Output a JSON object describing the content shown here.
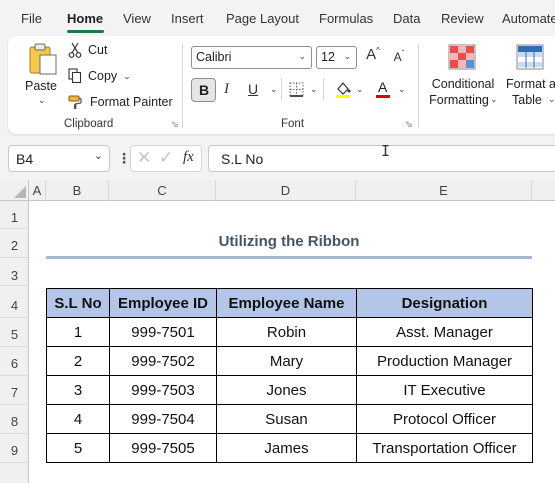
{
  "menu": {
    "tabs": [
      "File",
      "Home",
      "View",
      "Insert",
      "Page Layout",
      "Formulas",
      "Data",
      "Review",
      "Automate"
    ],
    "active": "Home"
  },
  "ribbon": {
    "clipboard": {
      "paste_label": "Paste",
      "cut_label": "Cut",
      "copy_label": "Copy",
      "format_painter_label": "Format Painter",
      "group_label": "Clipboard"
    },
    "font": {
      "font_name": "Calibri",
      "font_size": "12",
      "bold": "B",
      "italic": "I",
      "underline": "U",
      "grow": "A",
      "shrink": "A",
      "font_color_letter": "A",
      "group_label": "Font"
    },
    "styles": {
      "conditional_line1": "Conditional",
      "conditional_line2": "Formatting",
      "format_as_line1": "Format as",
      "format_as_line2": "Table"
    }
  },
  "formula_bar": {
    "name_box": "B4",
    "fx": "fx",
    "value": "S.L No"
  },
  "grid": {
    "columns": [
      "A",
      "B",
      "C",
      "D",
      "E"
    ],
    "rows": [
      "1",
      "2",
      "3",
      "4",
      "5",
      "6",
      "7",
      "8",
      "9"
    ]
  },
  "sheet": {
    "title": "Utilizing the Ribbon",
    "headers": [
      "S.L No",
      "Employee ID",
      "Employee Name",
      "Designation"
    ],
    "rows": [
      [
        "1",
        "999-7501",
        "Robin",
        "Asst. Manager"
      ],
      [
        "2",
        "999-7502",
        "Mary",
        "Production Manager"
      ],
      [
        "3",
        "999-7503",
        "Jones",
        "IT Executive"
      ],
      [
        "4",
        "999-7504",
        "Susan",
        "Protocol Officer"
      ],
      [
        "5",
        "999-7505",
        "James",
        "Transportation Officer"
      ]
    ]
  },
  "colors": {
    "accent_green": "#1a7a43",
    "header_fill": "#b4c6e7",
    "title_text": "#44546a",
    "title_rule": "#a6b9d9",
    "highlight_yellow": "#ffff00",
    "font_red": "#e00000"
  }
}
